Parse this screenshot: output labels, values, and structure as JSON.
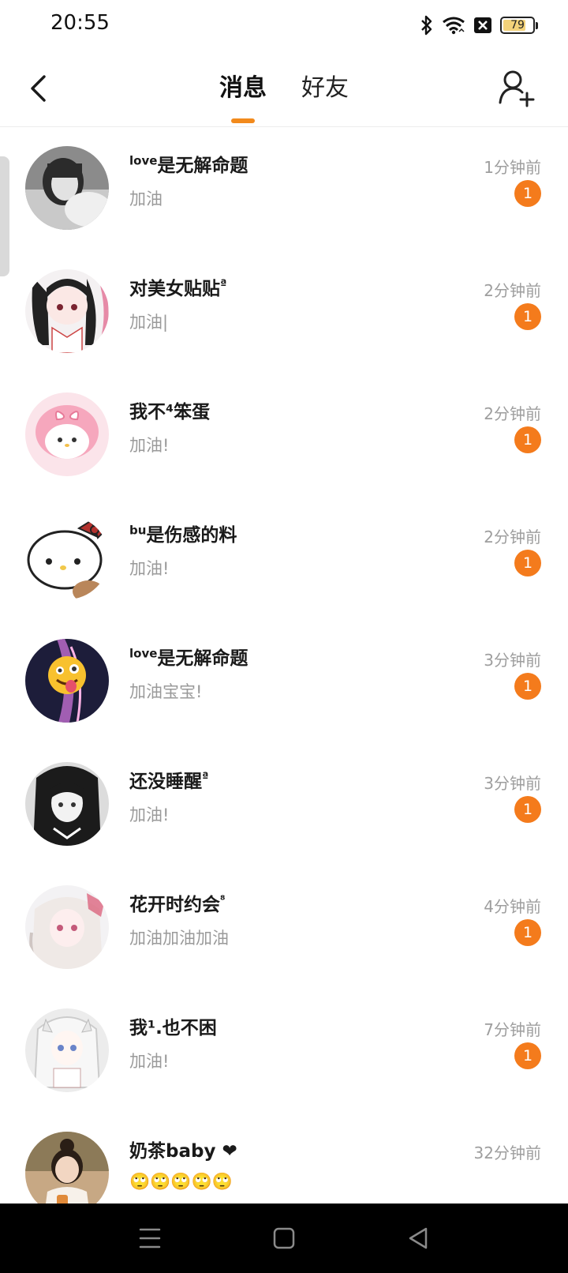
{
  "status_bar": {
    "time": "20:55",
    "battery_level": "79",
    "battery_fraction": 0.79,
    "icons": [
      "bluetooth-icon",
      "wifi-icon",
      "no-sim-icon",
      "battery-icon"
    ]
  },
  "header": {
    "tabs": [
      {
        "label": "消息",
        "active": true
      },
      {
        "label": "好友",
        "active": false
      }
    ],
    "accent_color": "#f28a1c",
    "icons": [
      "back-arrow-icon",
      "add-friend-icon"
    ]
  },
  "conversations": [
    {
      "name_sup": "love",
      "name": "是无解命题",
      "name_tail": "",
      "preview": "加油",
      "time": "1分钟前",
      "unread": "1",
      "avatar": "gray-girl-photo"
    },
    {
      "name_sup": "",
      "name": "对美女贴贴",
      "name_tail": "ª",
      "preview": "加油|",
      "time": "2分钟前",
      "unread": "1",
      "avatar": "anime-girl-pigtails"
    },
    {
      "name_sup": "",
      "name": "我不⁴笨蛋",
      "name_tail": "",
      "preview": "加油!",
      "time": "2分钟前",
      "unread": "1",
      "avatar": "pink-melody-bunny"
    },
    {
      "name_sup": "bu",
      "name": "是伤感的料",
      "name_tail": "",
      "preview": "加油!",
      "time": "2分钟前",
      "unread": "1",
      "avatar": "hello-kitty"
    },
    {
      "name_sup": "love",
      "name": "是无解命题",
      "name_tail": "",
      "preview": "加油宝宝!",
      "time": "3分钟前",
      "unread": "1",
      "avatar": "emoji-tongue-face"
    },
    {
      "name_sup": "",
      "name": "还没睡醒",
      "name_tail": "ª",
      "preview": "加油!",
      "time": "3分钟前",
      "unread": "1",
      "avatar": "dark-hair-anime-girl"
    },
    {
      "name_sup": "",
      "name": "花开时约会",
      "name_tail": "⁸",
      "preview": "加油加油加油",
      "time": "4分钟前",
      "unread": "1",
      "avatar": "white-hair-anime-girl"
    },
    {
      "name_sup": "",
      "name": "我¹.也不困",
      "name_tail": "",
      "preview": "加油!",
      "time": "7分钟前",
      "unread": "1",
      "avatar": "silver-hair-anime-girl"
    },
    {
      "name_sup": "",
      "name": "奶茶baby ❤",
      "name_tail": "",
      "preview": "🙄🙄🙄🙄🙄",
      "time": "32分钟前",
      "unread": "",
      "avatar": "girl-photo"
    }
  ],
  "badge_color": "#f47b1c",
  "nav_bar": {
    "icons": [
      "menu-icon",
      "home-icon",
      "back-triangle-icon"
    ]
  }
}
